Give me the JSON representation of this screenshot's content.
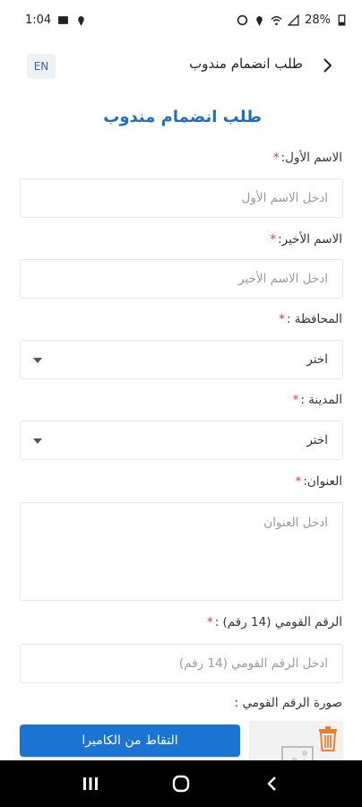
{
  "status": {
    "time": "1:04",
    "battery": "28%"
  },
  "header": {
    "title": "طلب انضمام مندوب",
    "lang": "EN"
  },
  "form": {
    "title": "طلب انضمام مندوب",
    "required_mark": "*",
    "first_name": {
      "label": "الاسم الأول:",
      "placeholder": "ادخل الاسم الأول"
    },
    "last_name": {
      "label": "الاسم الأخير:",
      "placeholder": "ادخل الاسم الأخير"
    },
    "governorate": {
      "label": "المحافظة :",
      "value": "اختر"
    },
    "city": {
      "label": "المدينة :",
      "value": "اختر"
    },
    "address": {
      "label": "العنوان:",
      "placeholder": "ادخل العنوان"
    },
    "national_id": {
      "label": "الرقم القومي (14 رقم) :",
      "placeholder": "ادخل الرقم القومي (14 رقم)"
    },
    "id_photo": {
      "label": "صورة الرقم القومي :",
      "camera_button": "التقاط من الكاميرا"
    }
  },
  "colors": {
    "accent": "#1b74d2",
    "title": "#1b6fc4",
    "required": "#e53935"
  },
  "icons": [
    "back-arrow-icon",
    "trash-icon",
    "image-placeholder-icon",
    "recents-icon",
    "home-icon",
    "back-icon"
  ]
}
